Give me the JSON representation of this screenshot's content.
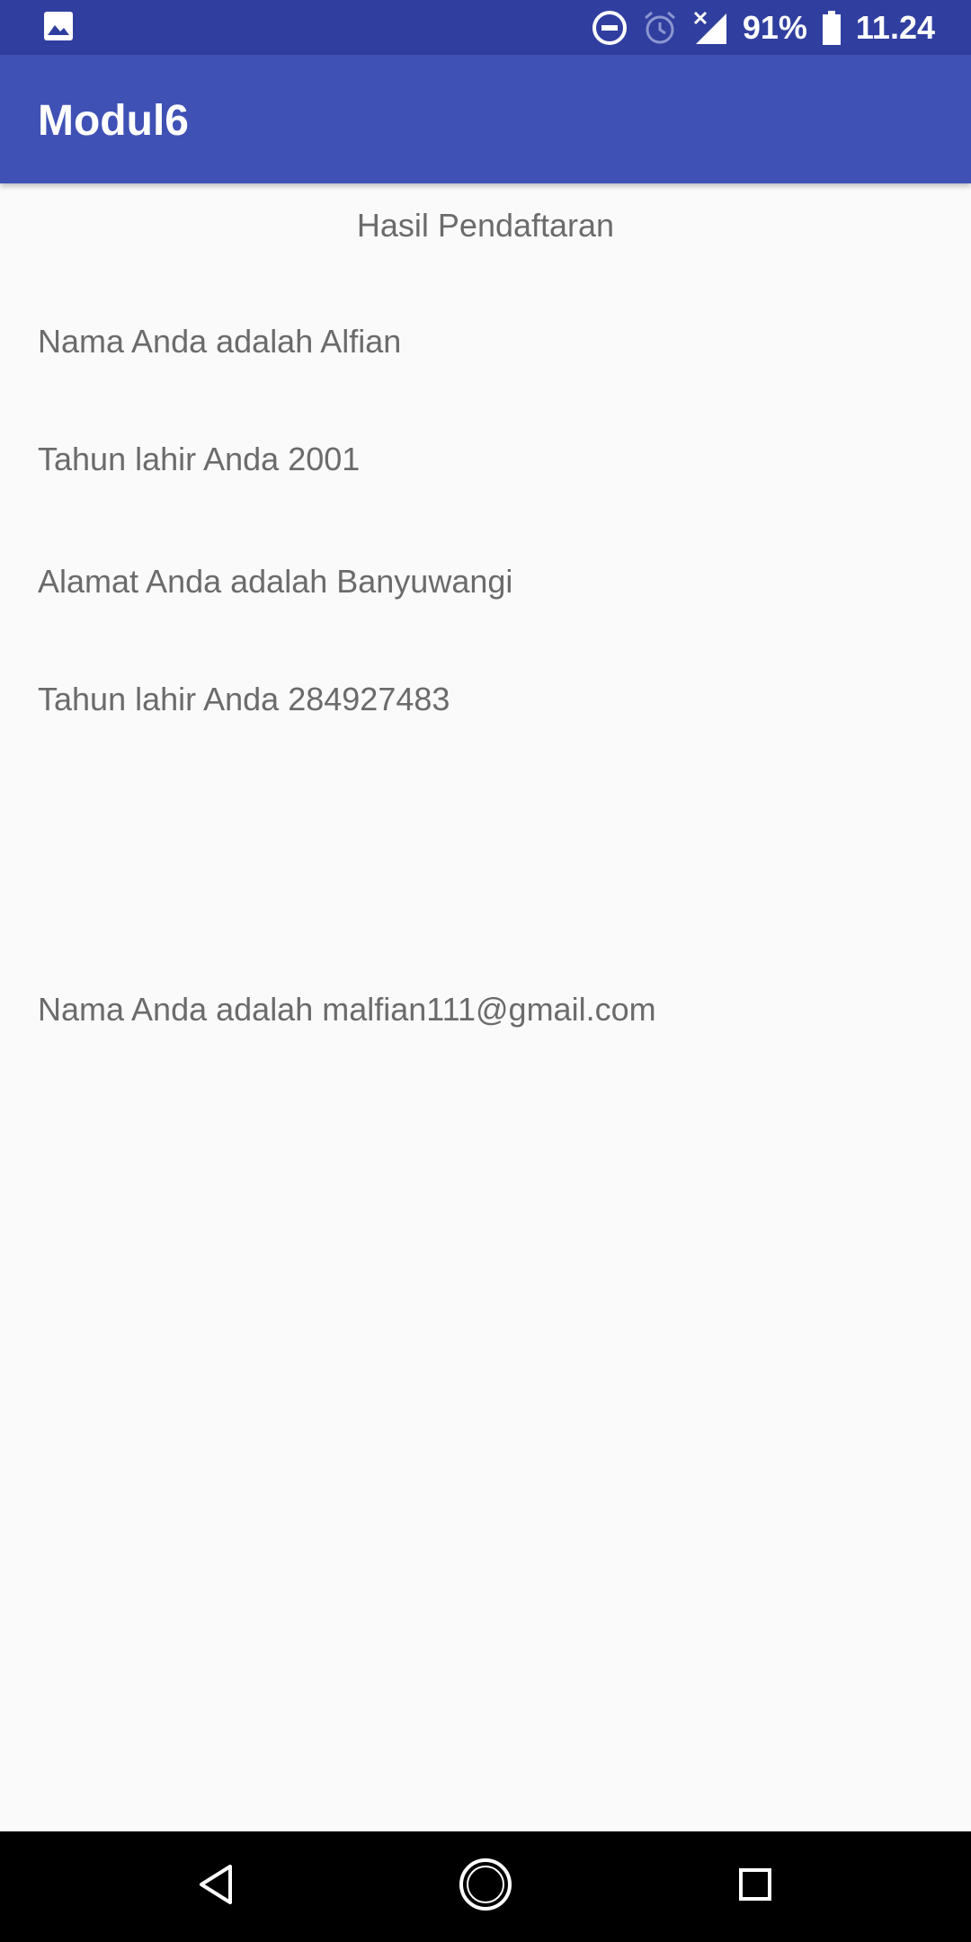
{
  "status_bar": {
    "battery_percent": "91%",
    "time": "11.24",
    "icons": [
      "gallery-icon",
      "do-not-disturb-icon",
      "alarm-icon",
      "signal-icon",
      "battery-icon"
    ]
  },
  "app_bar": {
    "title": "Modul6"
  },
  "content": {
    "heading": "Hasil Pendaftaran",
    "lines": [
      "Nama Anda adalah Alfian",
      "Tahun lahir Anda 2001",
      "Alamat Anda adalah Banyuwangi",
      "Tahun lahir Anda 284927483",
      "Nama Anda adalah malfian111@gmail.com"
    ]
  },
  "nav_bar": {
    "icons": [
      "back-icon",
      "home-icon",
      "recents-icon"
    ]
  },
  "colors": {
    "status_bar": "#303f9f",
    "app_bar": "#3f51b5",
    "background": "#fafafa",
    "text": "#6b6b6b"
  }
}
